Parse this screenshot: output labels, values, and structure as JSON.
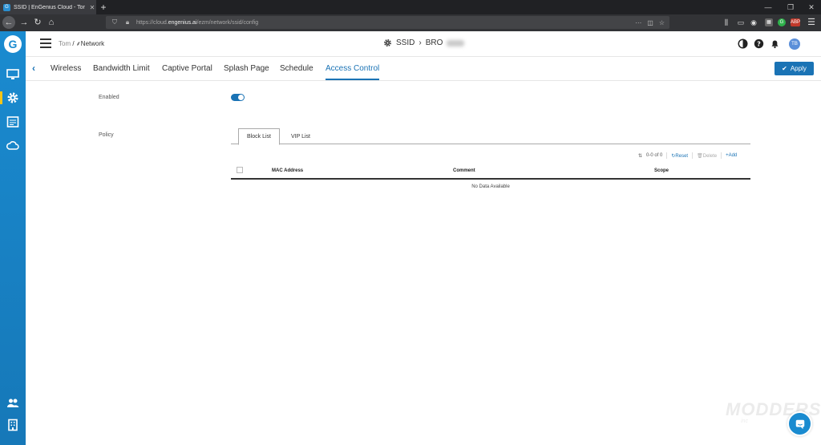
{
  "browser": {
    "tab_title": "SSID | EnGenius Cloud - Tom",
    "tab_favicon": "G",
    "url_prefix": "https://cloud.",
    "url_domain": "engenius.ai",
    "url_path": "/ezm/network/ssid/config",
    "url_actions": "···",
    "extensions": [
      "G",
      "ABP"
    ]
  },
  "app": {
    "logo": "G",
    "breadcrumb": {
      "org": "Tom",
      "separator": " / ",
      "network": "Network"
    },
    "page_title": "SSID",
    "page_title_separator": "›",
    "ssid_name_visible": "BRO",
    "avatar_initials": "TB"
  },
  "tabs": {
    "items": [
      "Wireless",
      "Bandwidth Limit",
      "Captive Portal",
      "Splash Page",
      "Schedule",
      "Access Control"
    ],
    "active": "Access Control"
  },
  "apply_label": "Apply",
  "form": {
    "enabled_label": "Enabled",
    "enabled_value": true,
    "policy_label": "Policy"
  },
  "policy_tabs": {
    "block_list": "Block List",
    "vip_list": "VIP List",
    "active": "Block List"
  },
  "table": {
    "pager": "0-0 of 0",
    "reset_label": "Reset",
    "delete_label": "Delete",
    "add_label": "Add",
    "columns": [
      "MAC Address",
      "Comment",
      "Scope"
    ],
    "empty_text": "No Data Available"
  },
  "watermark": {
    "title": "MODDERS",
    "subtitle": "inc"
  },
  "colors": {
    "accent": "#1a73b5",
    "sidebar": "#1a8bd0"
  }
}
